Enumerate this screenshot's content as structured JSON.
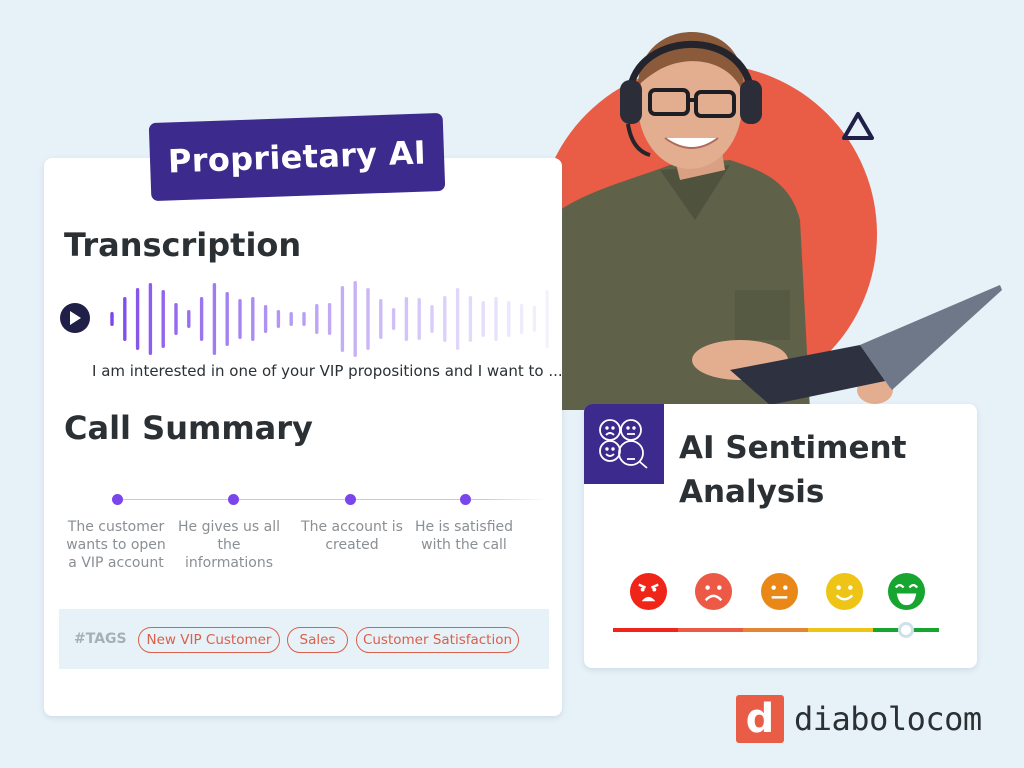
{
  "badge": {
    "label": "Proprietary AI"
  },
  "transcription": {
    "title": "Transcription",
    "text": "I am interested in one of your VIP propositions and I want to ...",
    "waveform_levels": [
      14,
      44,
      62,
      72,
      58,
      32,
      18,
      44,
      72,
      54,
      40,
      44,
      28,
      18,
      14,
      14,
      30,
      32,
      66,
      76,
      62,
      40,
      22,
      44,
      42,
      28,
      46,
      62,
      46,
      36,
      44,
      36,
      30,
      26,
      58
    ]
  },
  "summary": {
    "title": "Call Summary",
    "steps": [
      {
        "text": "The customer wants to open a VIP account"
      },
      {
        "text": "He gives us all the informations"
      },
      {
        "text": "The account is created"
      },
      {
        "text": "He is satisfied with the call"
      }
    ]
  },
  "tags": {
    "label": "#TAGS",
    "items": [
      "New VIP Customer",
      "Sales",
      "Customer Satisfaction"
    ]
  },
  "sentiment": {
    "title_line1": "AI Sentiment",
    "title_line2": "Analysis",
    "levels": [
      {
        "name": "angry",
        "color": "#f0251a"
      },
      {
        "name": "sad",
        "color": "#ec5a45"
      },
      {
        "name": "neutral",
        "color": "#ea8817"
      },
      {
        "name": "happy",
        "color": "#eec416"
      },
      {
        "name": "very-happy",
        "color": "#16a52e"
      }
    ],
    "slider_value_percent": 90
  },
  "brand": {
    "logo_letter": "d",
    "name": "diabolocom",
    "accent": "#e95c45",
    "primary": "#3c2a8c"
  }
}
